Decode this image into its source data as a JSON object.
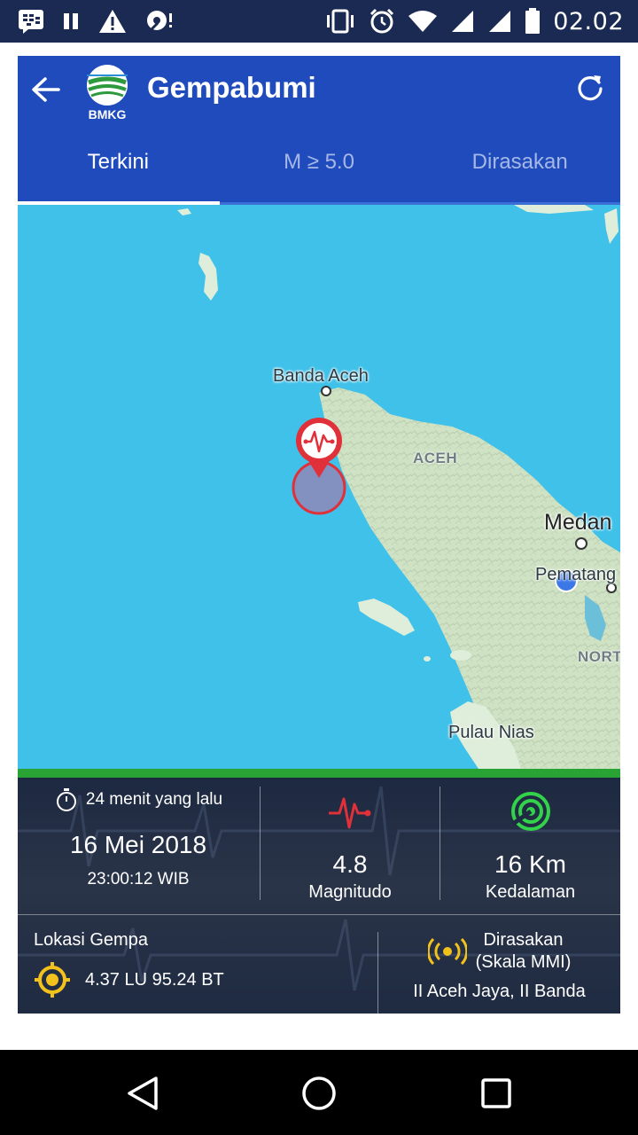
{
  "status_bar": {
    "time": "02.02",
    "icons_left": [
      "blackberry-messenger-icon",
      "pause-icon",
      "warning-icon",
      "vpn-icon"
    ],
    "icons_right": [
      "vibrate-icon",
      "alarm-icon",
      "wifi-icon",
      "signal-icon",
      "signal-icon",
      "battery-icon"
    ]
  },
  "app_bar": {
    "logo_text": "BMKG",
    "title": "Gempabumi"
  },
  "tabs": [
    {
      "label": "Terkini",
      "active": true
    },
    {
      "label": "M ≥ 5.0",
      "active": false
    },
    {
      "label": "Dirasakan",
      "active": false
    }
  ],
  "map": {
    "labels": {
      "banda_aceh": "Banda Aceh",
      "aceh": "ACEH",
      "medan": "Medan",
      "pematang": "Pematang",
      "north": "NORT",
      "pulau_nias": "Pulau Nias"
    }
  },
  "info": {
    "time_ago": "24 menit yang lalu",
    "date": "16 Mei 2018",
    "time": "23:00:12 WIB",
    "magnitude_value": "4.8",
    "magnitude_label": "Magnitudo",
    "depth_value": "16 Km",
    "depth_label": "Kedalaman",
    "location_label": "Lokasi Gempa",
    "location_value": "4.37 LU 95.24 BT",
    "felt_label_1": "Dirasakan",
    "felt_label_2": "(Skala MMI)",
    "felt_value": "II Aceh Jaya, II Banda"
  },
  "colors": {
    "status_bar": "#1b2a52",
    "app_bar": "#1f4bbd",
    "sea": "#3fc1e9",
    "land": "#cfe2c4",
    "marker_red": "#e0303a",
    "depth_green": "#32d34a",
    "location_yellow": "#f3c11b"
  }
}
